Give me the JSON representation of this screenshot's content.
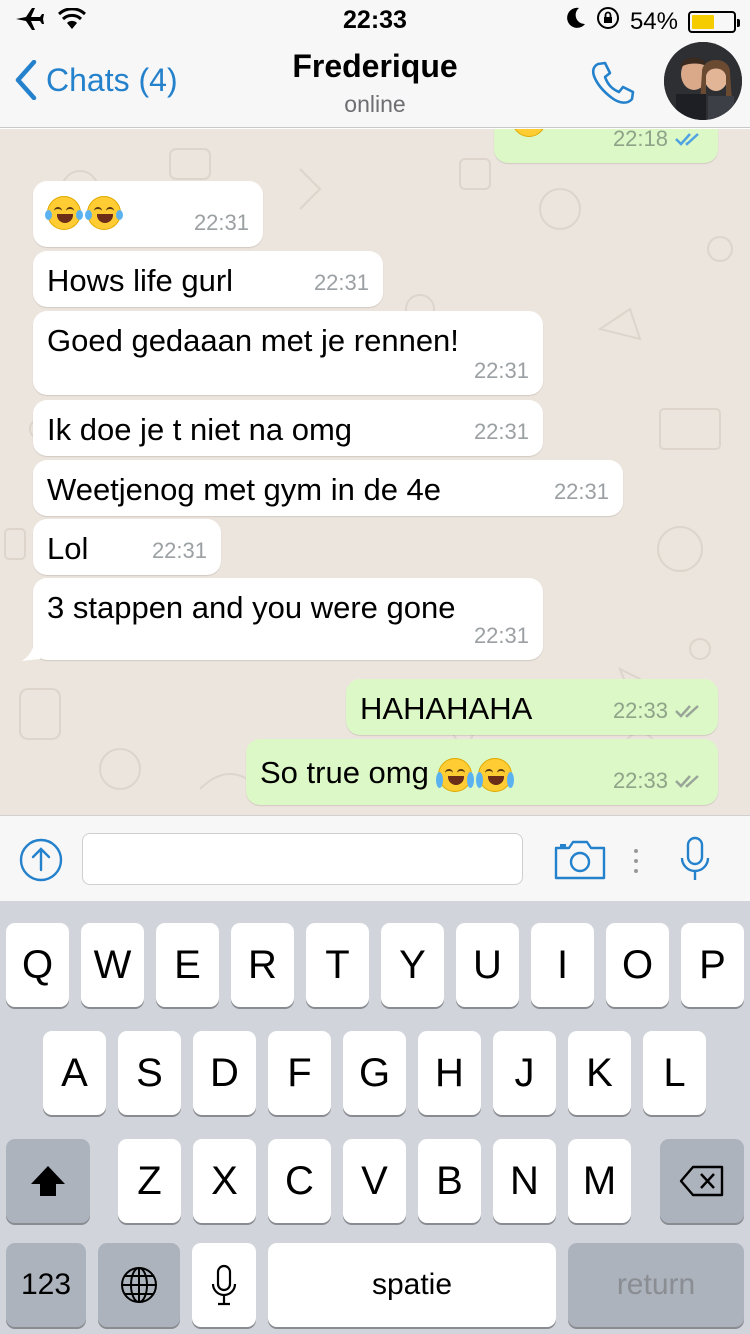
{
  "status_bar": {
    "time": "22:33",
    "battery_percent": "54%",
    "battery_level": 0.54,
    "icons": [
      "airplane-icon",
      "wifi-icon",
      "moon-icon",
      "rotation-lock-icon",
      "battery-icon"
    ]
  },
  "nav": {
    "back_label": "Chats (4)",
    "title": "Frederique",
    "subtitle": "online",
    "accent": "#2481cc"
  },
  "messages": [
    {
      "dir": "out",
      "text": "",
      "time": "22:18",
      "ticks": "blue"
    },
    {
      "dir": "in",
      "text": "😂😂",
      "time": "22:31"
    },
    {
      "dir": "in",
      "text": "Hows life gurl",
      "time": "22:31"
    },
    {
      "dir": "in",
      "text": "Goed gedaaan met je rennen!",
      "time": "22:31"
    },
    {
      "dir": "in",
      "text": "Ik doe je t niet na omg",
      "time": "22:31"
    },
    {
      "dir": "in",
      "text": "Weetjenog met gym in de 4e",
      "time": "22:31"
    },
    {
      "dir": "in",
      "text": "Lol",
      "time": "22:31"
    },
    {
      "dir": "in",
      "text": "3 stappen and you were gone",
      "time": "22:31"
    },
    {
      "dir": "out",
      "text": "HAHAHAHA",
      "time": "22:33",
      "ticks": "grey"
    },
    {
      "dir": "out",
      "text": "So true omg 😭😭",
      "time": "22:33",
      "ticks": "grey"
    }
  ],
  "input": {
    "placeholder": ""
  },
  "keyboard": {
    "row1": [
      "Q",
      "W",
      "E",
      "R",
      "T",
      "Y",
      "U",
      "I",
      "O",
      "P"
    ],
    "row2": [
      "A",
      "S",
      "D",
      "F",
      "G",
      "H",
      "J",
      "K",
      "L"
    ],
    "row3": [
      "Z",
      "X",
      "C",
      "V",
      "B",
      "N",
      "M"
    ],
    "numbers_label": "123",
    "space_label": "spatie",
    "return_label": "return"
  },
  "colors": {
    "incoming_bubble": "#ffffff",
    "outgoing_bubble": "#dcf8c6",
    "chat_background": "#ece5dd",
    "read_tick": "#4fa3e0"
  }
}
